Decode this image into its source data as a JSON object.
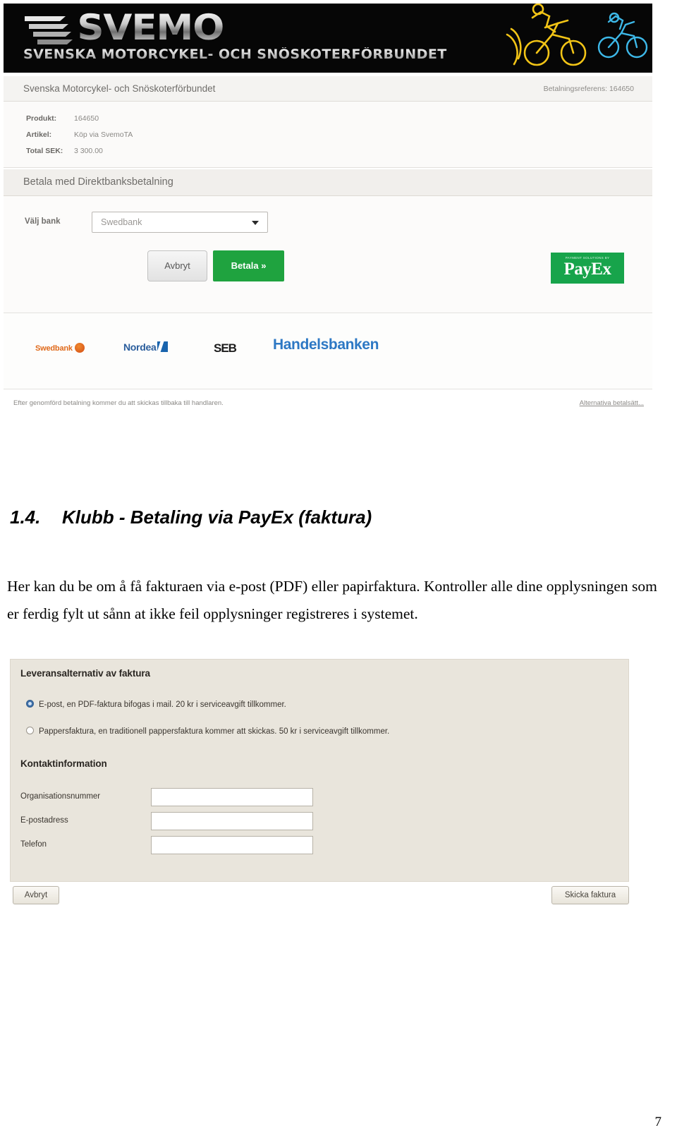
{
  "payex_screenshot": {
    "banner": {
      "logo_word": "SVEMO",
      "logo_subtitle": "SVENSKA MOTORCYKEL- OCH SNÖSKOTERFÖRBUNDET"
    },
    "merchant": {
      "name": "Svenska Motorcykel- och Snöskoterförbundet",
      "payment_reference": "Betalningsreferens: 164650"
    },
    "product": {
      "rows": [
        {
          "key": "Produkt:",
          "value": "164650"
        },
        {
          "key": "Artikel:",
          "value": "Köp via SvemoTA"
        },
        {
          "key": "Total SEK:",
          "value": "3 300.00"
        }
      ]
    },
    "section_title": "Betala med Direktbanksbetalning",
    "bank_picker": {
      "label": "Välj bank",
      "selected": "Swedbank"
    },
    "buttons": {
      "cancel": "Avbryt",
      "pay": "Betala »"
    },
    "payex_logo": {
      "tagline": "PAYMENT SOLUTIONS BY",
      "name": "PayEx"
    },
    "bank_logos": [
      {
        "name": "Swedbank",
        "color": "#e06a1b"
      },
      {
        "name": "Nordea",
        "color": "#2a5d9c"
      },
      {
        "name": "SEB",
        "color": "#1c1c1c"
      },
      {
        "name": "Handelsbanken",
        "color": "#2d78c4"
      }
    ],
    "footer": {
      "note": "Efter genomförd betalning kommer du att skickas tillbaka till handlaren.",
      "alt_link": "Alternativa betalsätt..."
    }
  },
  "document": {
    "heading_number": "1.4.",
    "heading_text": "Klubb - Betaling via PayEx (faktura)",
    "body": "Her kan du be om å få fakturaen via e-post (PDF) eller papirfaktura. Kontroller alle dine opplysningen som er ferdig fylt ut sånn at ikke feil opplysninger registreres i systemet.",
    "page_number": "7"
  },
  "invoice_form_screenshot": {
    "delivery_heading": "Leveransalternativ av faktura",
    "delivery_options": [
      {
        "label": "E-post, en PDF-faktura bifogas i mail. 20 kr i serviceavgift tillkommer.",
        "selected": true
      },
      {
        "label": "Pappersfaktura, en traditionell pappersfaktura kommer att skickas. 50 kr i serviceavgift tillkommer.",
        "selected": false
      }
    ],
    "contact_heading": "Kontaktinformation",
    "fields": [
      {
        "label": "Organisationsnummer",
        "value": ""
      },
      {
        "label": "E-postadress",
        "value": ""
      },
      {
        "label": "Telefon",
        "value": ""
      }
    ],
    "buttons": {
      "cancel": "Avbryt",
      "send_invoice": "Skicka faktura"
    }
  }
}
